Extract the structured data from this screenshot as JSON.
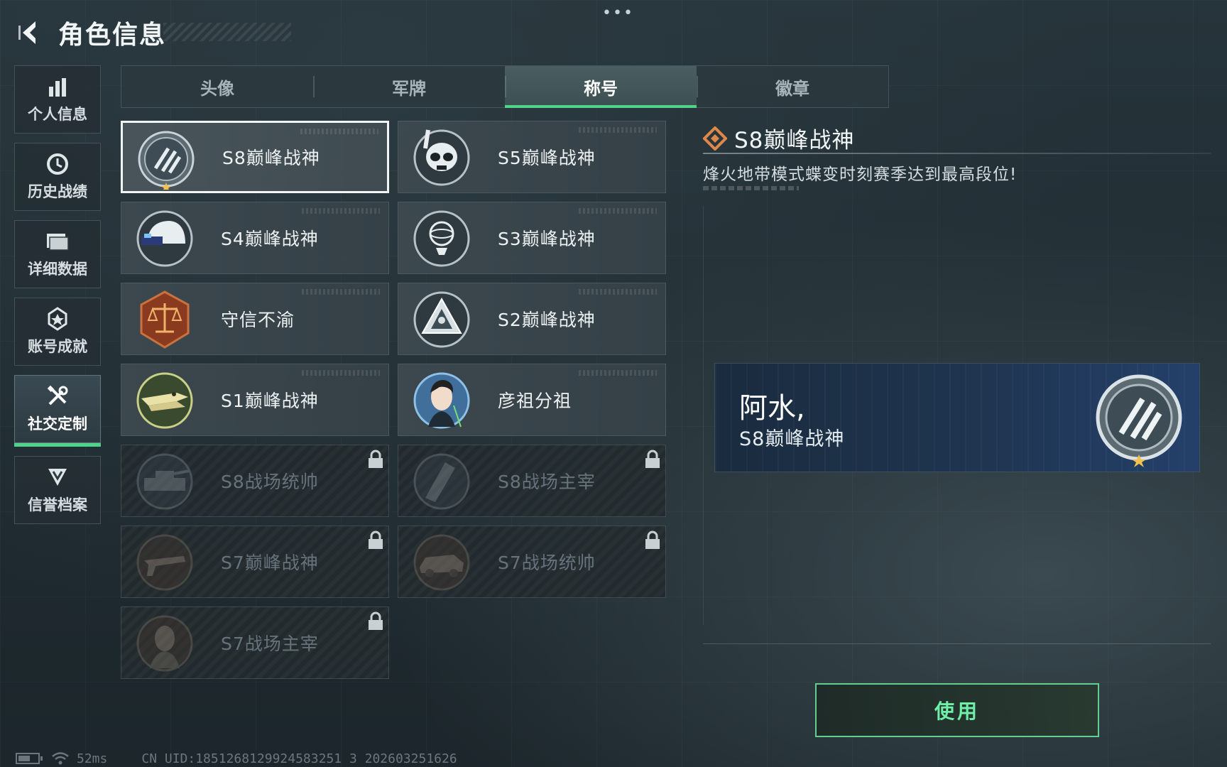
{
  "header": {
    "title": "角色信息",
    "menu_dots": "•••"
  },
  "nav": {
    "items": [
      {
        "label": "个人信息",
        "icon": "bar-chart-icon"
      },
      {
        "label": "历史战绩",
        "icon": "history-clock-icon"
      },
      {
        "label": "详细数据",
        "icon": "folder-icon"
      },
      {
        "label": "账号成就",
        "icon": "achievement-icon"
      },
      {
        "label": "社交定制",
        "icon": "tools-icon",
        "active": true
      },
      {
        "label": "信誉档案",
        "icon": "shield-rank-icon"
      }
    ]
  },
  "tabs": [
    {
      "label": "头像"
    },
    {
      "label": "军牌"
    },
    {
      "label": "称号",
      "active": true
    },
    {
      "label": "徽章"
    }
  ],
  "titles": [
    {
      "label": "S8巅峰战神",
      "icon": "s8-peak-emblem-icon",
      "locked": false,
      "selected": true
    },
    {
      "label": "S5巅峰战神",
      "icon": "s5-skull-emblem-icon",
      "locked": false
    },
    {
      "label": "S4巅峰战神",
      "icon": "s4-helmet-emblem-icon",
      "locked": false
    },
    {
      "label": "S3巅峰战神",
      "icon": "s3-globe-emblem-icon",
      "locked": false
    },
    {
      "label": "守信不渝",
      "icon": "scales-emblem-icon",
      "locked": false
    },
    {
      "label": "S2巅峰战神",
      "icon": "s2-triangle-emblem-icon",
      "locked": false
    },
    {
      "label": "S1巅峰战神",
      "icon": "s1-crocodile-emblem-icon",
      "locked": false
    },
    {
      "label": "彦祖分祖",
      "icon": "portrait-emblem-icon",
      "locked": false
    },
    {
      "label": "S8战场统帅",
      "icon": "s8-tank-emblem-icon",
      "locked": true
    },
    {
      "label": "S8战场主宰",
      "icon": "s8-tower-emblem-icon",
      "locked": true
    },
    {
      "label": "S7巅峰战神",
      "icon": "s7-gun-emblem-icon",
      "locked": true
    },
    {
      "label": "S7战场统帅",
      "icon": "s7-vehicle-emblem-icon",
      "locked": true
    },
    {
      "label": "S7战场主宰",
      "icon": "s7-soldier-emblem-icon",
      "locked": true
    }
  ],
  "detail": {
    "title": "S8巅峰战神",
    "description": "烽火地带模式蝶变时刻赛季达到最高段位!",
    "preview": {
      "player_name": "阿水,",
      "title": "S8巅峰战神"
    },
    "use_button": "使用"
  },
  "status": {
    "ping": "52ms",
    "uid": "CN UID:1851268129924583251 3 202603251626",
    "battery_level": 0.6
  },
  "colors": {
    "accent_green": "#4fd38a",
    "button_text": "#6ff0a8",
    "card_blue": "#1f3550"
  }
}
